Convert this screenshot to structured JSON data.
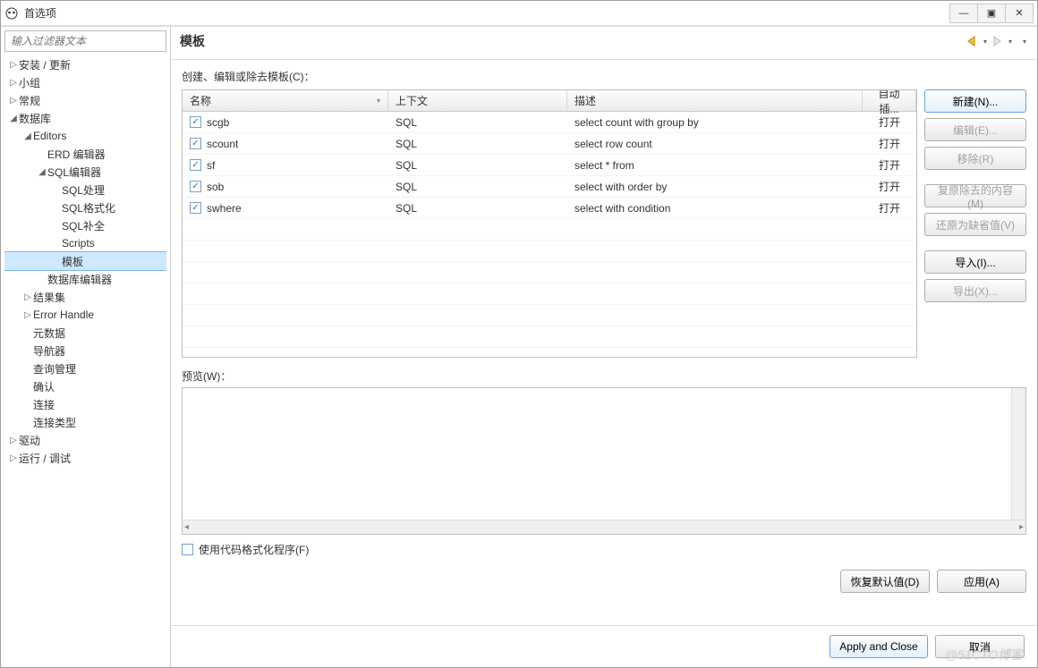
{
  "window": {
    "title": "首选项"
  },
  "sidebar": {
    "filter_placeholder": "输入过滤器文本",
    "items": [
      {
        "label": "安装 / 更新",
        "depth": 0,
        "exp": "▷"
      },
      {
        "label": "小组",
        "depth": 0,
        "exp": "▷"
      },
      {
        "label": "常规",
        "depth": 0,
        "exp": "▷"
      },
      {
        "label": "数据库",
        "depth": 0,
        "exp": "◢"
      },
      {
        "label": "Editors",
        "depth": 1,
        "exp": "◢"
      },
      {
        "label": "ERD 编辑器",
        "depth": 2,
        "exp": ""
      },
      {
        "label": "SQL编辑器",
        "depth": 2,
        "exp": "◢"
      },
      {
        "label": "SQL处理",
        "depth": 3,
        "exp": ""
      },
      {
        "label": "SQL格式化",
        "depth": 3,
        "exp": ""
      },
      {
        "label": "SQL补全",
        "depth": 3,
        "exp": ""
      },
      {
        "label": "Scripts",
        "depth": 3,
        "exp": ""
      },
      {
        "label": "模板",
        "depth": 3,
        "exp": "",
        "selected": true
      },
      {
        "label": "数据库编辑器",
        "depth": 2,
        "exp": ""
      },
      {
        "label": "结果集",
        "depth": 1,
        "exp": "▷"
      },
      {
        "label": "Error Handle",
        "depth": 1,
        "exp": "▷"
      },
      {
        "label": "元数据",
        "depth": 1,
        "exp": ""
      },
      {
        "label": "导航器",
        "depth": 1,
        "exp": ""
      },
      {
        "label": "查询管理",
        "depth": 1,
        "exp": ""
      },
      {
        "label": "确认",
        "depth": 1,
        "exp": ""
      },
      {
        "label": "连接",
        "depth": 1,
        "exp": ""
      },
      {
        "label": "连接类型",
        "depth": 1,
        "exp": ""
      },
      {
        "label": "驱动",
        "depth": 0,
        "exp": "▷"
      },
      {
        "label": "运行 / 调试",
        "depth": 0,
        "exp": "▷"
      }
    ]
  },
  "main": {
    "title": "模板",
    "instruction": "创建、编辑或除去模板(C)：",
    "columns": {
      "name": "名称",
      "context": "上下文",
      "desc": "描述",
      "auto": "自动插..."
    },
    "rows": [
      {
        "checked": true,
        "name": "scgb",
        "context": "SQL",
        "desc": "select count with group by",
        "auto": "打开"
      },
      {
        "checked": true,
        "name": "scount",
        "context": "SQL",
        "desc": "select row count",
        "auto": "打开"
      },
      {
        "checked": true,
        "name": "sf",
        "context": "SQL",
        "desc": "select * from",
        "auto": "打开"
      },
      {
        "checked": true,
        "name": "sob",
        "context": "SQL",
        "desc": "select with order by",
        "auto": "打开"
      },
      {
        "checked": true,
        "name": "swhere",
        "context": "SQL",
        "desc": "select with condition",
        "auto": "打开"
      }
    ],
    "buttons": {
      "new": "新建(N)...",
      "edit": "编辑(E)...",
      "remove": "移除(R)",
      "restore_removed": "复原除去的内容(M)",
      "revert": "还原为缺省值(V)",
      "import": "导入(I)...",
      "export": "导出(X)..."
    },
    "preview_label": "预览(W)：",
    "use_formatter": "使用代码格式化程序(F)",
    "restore_defaults": "恢复默认值(D)",
    "apply": "应用(A)"
  },
  "footer": {
    "apply_close": "Apply and Close",
    "cancel": "取消"
  },
  "watermark": "@51CTO博客"
}
